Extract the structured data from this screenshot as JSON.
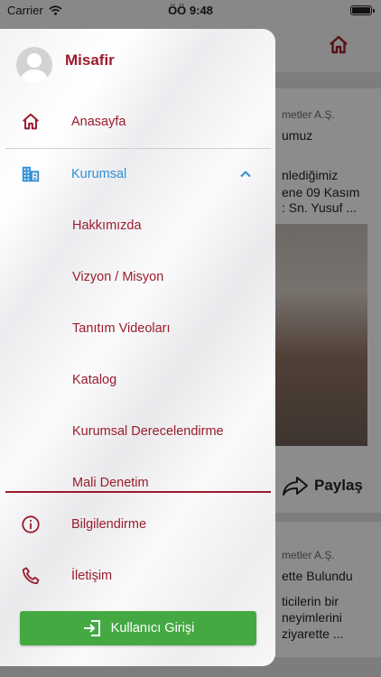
{
  "status_bar": {
    "carrier": "Carrier",
    "time": "ÖÖ 9:48"
  },
  "background": {
    "card1_lines": [
      "metler A.Ş.",
      "umuz",
      "nlediğimiz",
      "ene 09 Kasım",
      ": Sn. Yusuf ..."
    ],
    "share_label": "Paylaş",
    "card2_lines": [
      "metler A.Ş.",
      "ette Bulundu",
      "ticilerin bir",
      "neyimlerini",
      "ziyarette ..."
    ]
  },
  "drawer": {
    "user_name": "Misafir",
    "home_label": "Anasayfa",
    "corporate_label": "Kurumsal",
    "corporate_items": [
      "Hakkımızda",
      "Vizyon / Misyon",
      "Tanıtım Videoları",
      "Katalog",
      "Kurumsal Derecelendirme",
      "Mali Denetim"
    ],
    "info_label": "Bilgilendirme",
    "contact_label": "İletişim",
    "login_label": "Kullanıcı Girişi"
  },
  "colors": {
    "brand": "#9b1c2b",
    "active": "#2b8fd6",
    "login": "#45a943"
  }
}
